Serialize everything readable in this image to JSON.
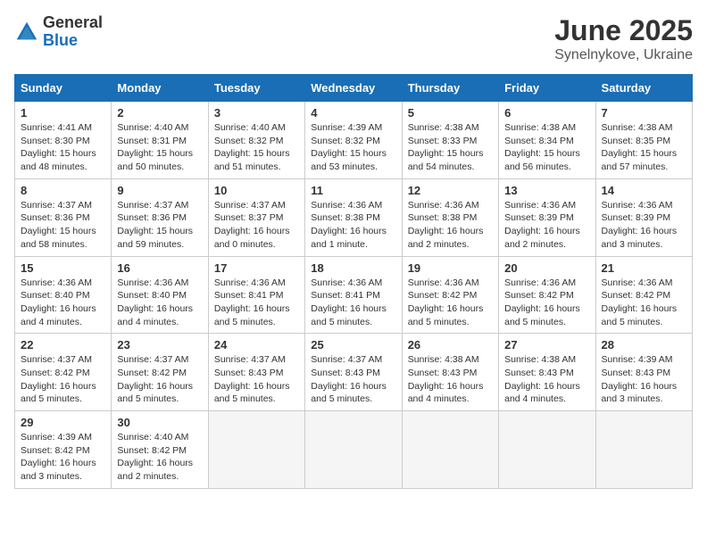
{
  "logo": {
    "general": "General",
    "blue": "Blue"
  },
  "title": "June 2025",
  "subtitle": "Synelnykove, Ukraine",
  "headers": [
    "Sunday",
    "Monday",
    "Tuesday",
    "Wednesday",
    "Thursday",
    "Friday",
    "Saturday"
  ],
  "weeks": [
    [
      {
        "day": "1",
        "sunrise": "4:41 AM",
        "sunset": "8:30 PM",
        "daylight": "15 hours and 48 minutes."
      },
      {
        "day": "2",
        "sunrise": "4:40 AM",
        "sunset": "8:31 PM",
        "daylight": "15 hours and 50 minutes."
      },
      {
        "day": "3",
        "sunrise": "4:40 AM",
        "sunset": "8:32 PM",
        "daylight": "15 hours and 51 minutes."
      },
      {
        "day": "4",
        "sunrise": "4:39 AM",
        "sunset": "8:32 PM",
        "daylight": "15 hours and 53 minutes."
      },
      {
        "day": "5",
        "sunrise": "4:38 AM",
        "sunset": "8:33 PM",
        "daylight": "15 hours and 54 minutes."
      },
      {
        "day": "6",
        "sunrise": "4:38 AM",
        "sunset": "8:34 PM",
        "daylight": "15 hours and 56 minutes."
      },
      {
        "day": "7",
        "sunrise": "4:38 AM",
        "sunset": "8:35 PM",
        "daylight": "15 hours and 57 minutes."
      }
    ],
    [
      {
        "day": "8",
        "sunrise": "4:37 AM",
        "sunset": "8:36 PM",
        "daylight": "15 hours and 58 minutes."
      },
      {
        "day": "9",
        "sunrise": "4:37 AM",
        "sunset": "8:36 PM",
        "daylight": "15 hours and 59 minutes."
      },
      {
        "day": "10",
        "sunrise": "4:37 AM",
        "sunset": "8:37 PM",
        "daylight": "16 hours and 0 minutes."
      },
      {
        "day": "11",
        "sunrise": "4:36 AM",
        "sunset": "8:38 PM",
        "daylight": "16 hours and 1 minute."
      },
      {
        "day": "12",
        "sunrise": "4:36 AM",
        "sunset": "8:38 PM",
        "daylight": "16 hours and 2 minutes."
      },
      {
        "day": "13",
        "sunrise": "4:36 AM",
        "sunset": "8:39 PM",
        "daylight": "16 hours and 2 minutes."
      },
      {
        "day": "14",
        "sunrise": "4:36 AM",
        "sunset": "8:39 PM",
        "daylight": "16 hours and 3 minutes."
      }
    ],
    [
      {
        "day": "15",
        "sunrise": "4:36 AM",
        "sunset": "8:40 PM",
        "daylight": "16 hours and 4 minutes."
      },
      {
        "day": "16",
        "sunrise": "4:36 AM",
        "sunset": "8:40 PM",
        "daylight": "16 hours and 4 minutes."
      },
      {
        "day": "17",
        "sunrise": "4:36 AM",
        "sunset": "8:41 PM",
        "daylight": "16 hours and 5 minutes."
      },
      {
        "day": "18",
        "sunrise": "4:36 AM",
        "sunset": "8:41 PM",
        "daylight": "16 hours and 5 minutes."
      },
      {
        "day": "19",
        "sunrise": "4:36 AM",
        "sunset": "8:42 PM",
        "daylight": "16 hours and 5 minutes."
      },
      {
        "day": "20",
        "sunrise": "4:36 AM",
        "sunset": "8:42 PM",
        "daylight": "16 hours and 5 minutes."
      },
      {
        "day": "21",
        "sunrise": "4:36 AM",
        "sunset": "8:42 PM",
        "daylight": "16 hours and 5 minutes."
      }
    ],
    [
      {
        "day": "22",
        "sunrise": "4:37 AM",
        "sunset": "8:42 PM",
        "daylight": "16 hours and 5 minutes."
      },
      {
        "day": "23",
        "sunrise": "4:37 AM",
        "sunset": "8:42 PM",
        "daylight": "16 hours and 5 minutes."
      },
      {
        "day": "24",
        "sunrise": "4:37 AM",
        "sunset": "8:43 PM",
        "daylight": "16 hours and 5 minutes."
      },
      {
        "day": "25",
        "sunrise": "4:37 AM",
        "sunset": "8:43 PM",
        "daylight": "16 hours and 5 minutes."
      },
      {
        "day": "26",
        "sunrise": "4:38 AM",
        "sunset": "8:43 PM",
        "daylight": "16 hours and 4 minutes."
      },
      {
        "day": "27",
        "sunrise": "4:38 AM",
        "sunset": "8:43 PM",
        "daylight": "16 hours and 4 minutes."
      },
      {
        "day": "28",
        "sunrise": "4:39 AM",
        "sunset": "8:43 PM",
        "daylight": "16 hours and 3 minutes."
      }
    ],
    [
      {
        "day": "29",
        "sunrise": "4:39 AM",
        "sunset": "8:42 PM",
        "daylight": "16 hours and 3 minutes."
      },
      {
        "day": "30",
        "sunrise": "4:40 AM",
        "sunset": "8:42 PM",
        "daylight": "16 hours and 2 minutes."
      },
      null,
      null,
      null,
      null,
      null
    ]
  ]
}
